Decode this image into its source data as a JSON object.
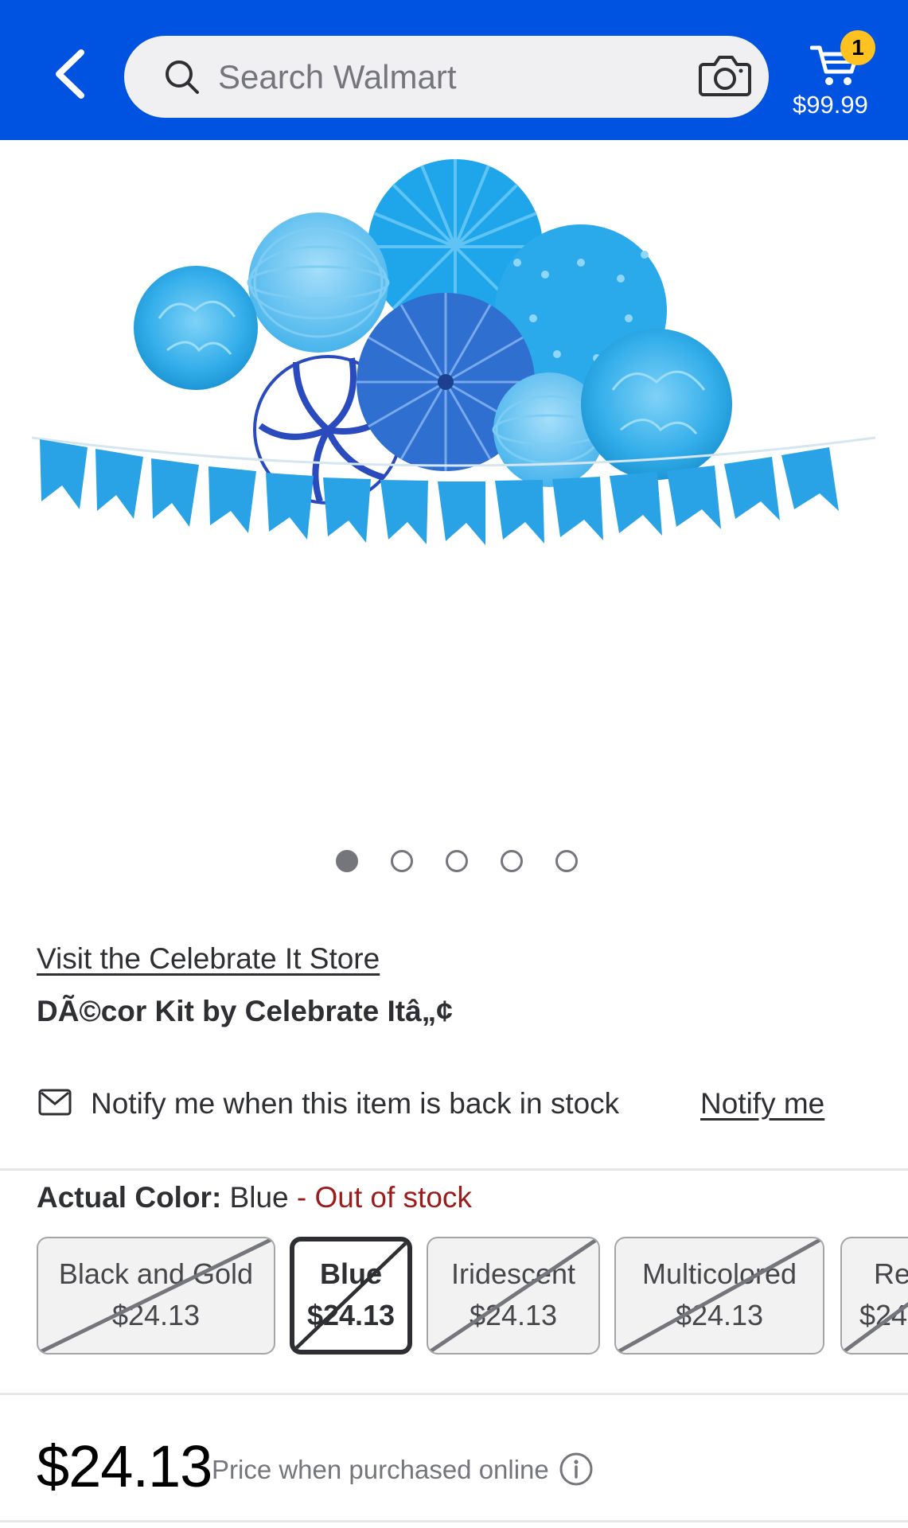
{
  "header": {
    "search_placeholder": "Search Walmart",
    "cart_count": "1",
    "cart_total": "$99.99",
    "icons": [
      "back-arrow-icon",
      "search-icon",
      "camera-icon",
      "cart-icon"
    ],
    "colors": {
      "brand_blue": "#0052e0",
      "badge_yellow": "#ffc220"
    }
  },
  "carousel": {
    "total_images": 5,
    "active_index": 0
  },
  "product": {
    "store_link": "Visit the Celebrate It Store",
    "title": "DÃ©cor Kit by Celebrate Itâ„¢"
  },
  "notify": {
    "text": "Notify me when this item is back in stock",
    "link": "Notify me"
  },
  "color": {
    "label": "Actual Color:",
    "value": " Blue",
    "status": " - Out of stock",
    "options": [
      {
        "name": "Black and Gold",
        "price": "$24.13"
      },
      {
        "name": "Blue",
        "price": "$24.13"
      },
      {
        "name": "Iridescent",
        "price": "$24.13"
      },
      {
        "name": "Multicolored",
        "price": "$24.13"
      },
      {
        "name": "Re",
        "price": "$24"
      }
    ]
  },
  "price": {
    "amount": "$24.13",
    "note": "Price when purchased online"
  }
}
